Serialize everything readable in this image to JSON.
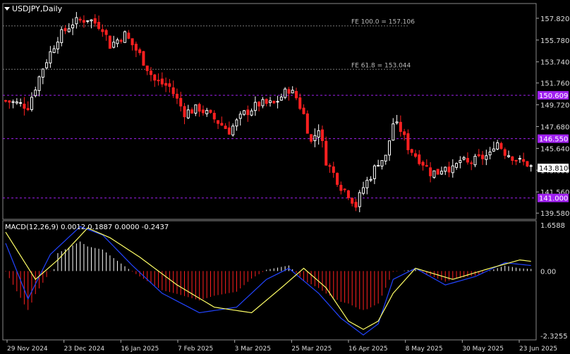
{
  "title": {
    "symbol": "USDJPY",
    "timeframe": "Daily",
    "text": "USDJPY,Daily"
  },
  "macd_header": "MACD(12,26,9) 0.0012 0.1887 0.0000 -0.2437",
  "colors": {
    "background": "#000000",
    "bull": "#ffffff",
    "bear": "#ff2020",
    "level_line": "#a020f0",
    "fib_line": "#777777",
    "macd_signal": "#ffff66",
    "macd_line": "#2244ff",
    "price_label_bg": "#ffffff"
  },
  "chart_data": [
    {
      "type": "candlestick",
      "title": "USDJPY,Daily",
      "ylim": [
        139.0,
        159.2
      ],
      "y_ticks": [
        "157.820",
        "155.780",
        "153.740",
        "151.760",
        "149.720",
        "147.680",
        "145.640",
        "143.600",
        "141.560",
        "139.580"
      ],
      "x_ticks": [
        "29 Nov 2024",
        "23 Dec 2024",
        "16 Jan 2025",
        "7 Feb 2025",
        "3 Mar 2025",
        "25 Mar 2025",
        "16 Apr 2025",
        "8 May 2025",
        "30 May 2025",
        "23 Jun 2025"
      ],
      "current_price": "143.810",
      "levels": [
        {
          "value": 150.609,
          "label": "150.609"
        },
        {
          "value": 146.55,
          "label": "146.550"
        },
        {
          "value": 141.0,
          "label": "141.000"
        }
      ],
      "fib_levels": [
        {
          "value": 157.106,
          "label": "FE 100.0 = 157.106"
        },
        {
          "value": 153.044,
          "label": "FE 61.8 = 153.044"
        }
      ],
      "close_path": [
        [
          0,
          150.1
        ],
        [
          6,
          149.6
        ],
        [
          10,
          153.2
        ],
        [
          14,
          156.0
        ],
        [
          18,
          157.4
        ],
        [
          22,
          157.8
        ],
        [
          26,
          157.0
        ],
        [
          28,
          155.3
        ],
        [
          32,
          156.3
        ],
        [
          36,
          154.4
        ],
        [
          40,
          152.0
        ],
        [
          44,
          151.4
        ],
        [
          48,
          149.0
        ],
        [
          52,
          149.4
        ],
        [
          56,
          148.4
        ],
        [
          60,
          147.3
        ],
        [
          64,
          148.9
        ],
        [
          68,
          149.8
        ],
        [
          72,
          149.8
        ],
        [
          76,
          151.2
        ],
        [
          78,
          150.4
        ],
        [
          80,
          148.8
        ],
        [
          82,
          146.2
        ],
        [
          84,
          147.6
        ],
        [
          86,
          144.5
        ],
        [
          88,
          143.3
        ],
        [
          90,
          142.1
        ],
        [
          92,
          141.4
        ],
        [
          94,
          140.3
        ],
        [
          96,
          142.0
        ],
        [
          98,
          143.1
        ],
        [
          100,
          144.4
        ],
        [
          102,
          144.8
        ],
        [
          104,
          148.0
        ],
        [
          106,
          147.4
        ],
        [
          108,
          145.8
        ],
        [
          110,
          145.0
        ],
        [
          112,
          144.3
        ],
        [
          114,
          143.4
        ],
        [
          116,
          143.4
        ],
        [
          118,
          144.1
        ],
        [
          120,
          143.6
        ],
        [
          122,
          144.5
        ],
        [
          124,
          144.2
        ],
        [
          126,
          144.5
        ],
        [
          128,
          144.8
        ],
        [
          130,
          145.0
        ],
        [
          131,
          146.0
        ],
        [
          132,
          146.2
        ],
        [
          134,
          145.3
        ],
        [
          136,
          144.9
        ],
        [
          138,
          144.4
        ],
        [
          140,
          144.2
        ],
        [
          141,
          143.9
        ]
      ],
      "n_candles": 142
    },
    {
      "type": "macd",
      "params": "12,26,9",
      "values": {
        "histogram": 0.0012,
        "signal": 0.1887,
        "line": 0.0,
        "extra": -0.2437
      },
      "ylim": [
        -2.3255,
        1.6588
      ],
      "y_ticks": [
        "1.6588",
        "0.00",
        "-2.3255"
      ],
      "signal_path": [
        [
          0,
          1.4
        ],
        [
          8,
          -0.3
        ],
        [
          14,
          0.4
        ],
        [
          22,
          1.55
        ],
        [
          28,
          1.2
        ],
        [
          36,
          0.5
        ],
        [
          46,
          -0.5
        ],
        [
          56,
          -1.3
        ],
        [
          66,
          -1.5
        ],
        [
          74,
          -0.6
        ],
        [
          80,
          0.1
        ],
        [
          86,
          -0.6
        ],
        [
          92,
          -1.8
        ],
        [
          96,
          -2.1
        ],
        [
          100,
          -1.8
        ],
        [
          104,
          -0.8
        ],
        [
          110,
          0.1
        ],
        [
          120,
          -0.3
        ],
        [
          130,
          0.1
        ],
        [
          138,
          0.4
        ],
        [
          141,
          0.35
        ]
      ],
      "line_path": [
        [
          0,
          1.0
        ],
        [
          6,
          -1.0
        ],
        [
          12,
          0.6
        ],
        [
          20,
          1.6
        ],
        [
          26,
          1.3
        ],
        [
          34,
          0.2
        ],
        [
          42,
          -0.8
        ],
        [
          52,
          -1.5
        ],
        [
          62,
          -1.3
        ],
        [
          70,
          -0.3
        ],
        [
          76,
          0.1
        ],
        [
          84,
          -0.8
        ],
        [
          90,
          -1.7
        ],
        [
          96,
          -2.3
        ],
        [
          100,
          -1.9
        ],
        [
          104,
          -0.3
        ],
        [
          110,
          0.1
        ],
        [
          118,
          -0.5
        ],
        [
          126,
          -0.2
        ],
        [
          134,
          0.3
        ],
        [
          141,
          0.2
        ]
      ]
    }
  ]
}
